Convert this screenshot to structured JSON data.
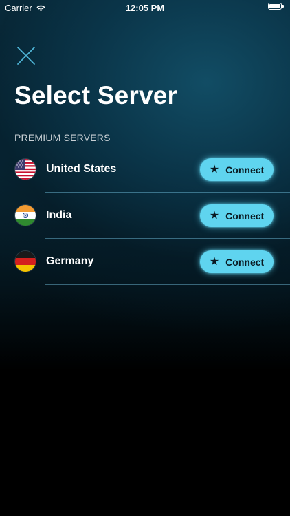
{
  "status_bar": {
    "carrier": "Carrier",
    "time": "12:05 PM",
    "wifi_icon": "wifi-icon",
    "battery_icon": "battery-full-icon"
  },
  "header": {
    "close_icon": "close-icon",
    "title": "Select Server"
  },
  "section": {
    "label": "PREMIUM SERVERS"
  },
  "servers": [
    {
      "country": "United States",
      "flag_icon": "us-flag-icon",
      "button_label": "Connect",
      "button_icon": "star-icon"
    },
    {
      "country": "India",
      "flag_icon": "india-flag-icon",
      "button_label": "Connect",
      "button_icon": "star-icon"
    },
    {
      "country": "Germany",
      "flag_icon": "germany-flag-icon",
      "button_label": "Connect",
      "button_icon": "star-icon"
    }
  ],
  "colors": {
    "accent": "#5fd4ef",
    "background_top": "#0b3a4f",
    "background_bottom": "#000000",
    "divider": "#78c8e6"
  }
}
